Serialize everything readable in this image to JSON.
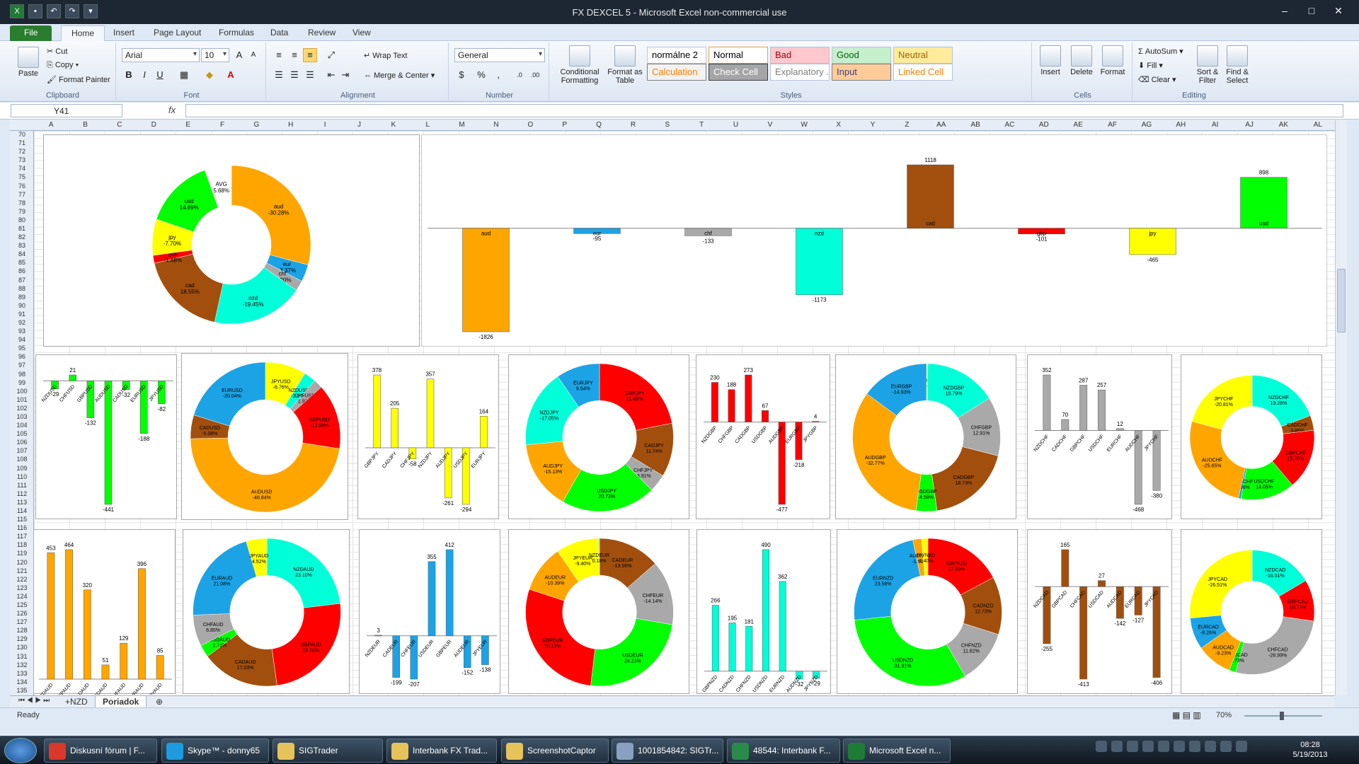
{
  "window": {
    "title": "FX DEXCEL 5  -  Microsoft Excel non-commercial use"
  },
  "tabs": [
    "File",
    "Home",
    "Insert",
    "Page Layout",
    "Formulas",
    "Data",
    "Review",
    "View"
  ],
  "ribbon": {
    "clipboard": {
      "paste": "Paste",
      "cut": "Cut",
      "copy": "Copy",
      "format_painter": "Format Painter",
      "label": "Clipboard"
    },
    "font": {
      "name": "Arial",
      "size": "10",
      "label": "Font"
    },
    "alignment": {
      "wrap": "Wrap Text",
      "merge": "Merge & Center",
      "label": "Alignment"
    },
    "number": {
      "format": "General",
      "label": "Number"
    },
    "styles": {
      "conditional": "Conditional Formatting",
      "format_table": "Format as Table",
      "cells": [
        {
          "label": "normálne 2",
          "bg": "#ffffff",
          "color": "#000000",
          "border": "#b6c4d6"
        },
        {
          "label": "Normal",
          "bg": "#ffffff",
          "color": "#000000",
          "border": "#e8a33a"
        },
        {
          "label": "Bad",
          "bg": "#ffc7ce",
          "color": "#9c0006",
          "border": "#b6c4d6"
        },
        {
          "label": "Good",
          "bg": "#c6efce",
          "color": "#006100",
          "border": "#b6c4d6"
        },
        {
          "label": "Neutral",
          "bg": "#ffeb9c",
          "color": "#9c6500",
          "border": "#b6c4d6"
        },
        {
          "label": "Calculation",
          "bg": "#f2f2f2",
          "color": "#fa7d00",
          "border": "#7f7f7f"
        },
        {
          "label": "Check Cell",
          "bg": "#a5a5a5",
          "color": "#ffffff",
          "border": "#3f3f3f"
        },
        {
          "label": "Explanatory ...",
          "bg": "#ffffff",
          "color": "#7f7f7f",
          "border": "#b6c4d6"
        },
        {
          "label": "Input",
          "bg": "#ffcc99",
          "color": "#3f3f76",
          "border": "#7f7f7f"
        },
        {
          "label": "Linked Cell",
          "bg": "#ffffff",
          "color": "#fa7d00",
          "border": "#b6c4d6"
        }
      ],
      "label": "Styles"
    },
    "cells": {
      "insert": "Insert",
      "delete": "Delete",
      "format": "Format",
      "label": "Cells"
    },
    "editing": {
      "autosum": "AutoSum",
      "fill": "Fill",
      "clear": "Clear",
      "sort": "Sort & Filter",
      "find": "Find & Select",
      "label": "Editing"
    }
  },
  "formula_bar": {
    "name_box": "Y41",
    "fx": "fx",
    "value": ""
  },
  "columns": [
    "A",
    "B",
    "C",
    "D",
    "E",
    "F",
    "G",
    "H",
    "I",
    "J",
    "K",
    "L",
    "M",
    "N",
    "O",
    "P",
    "Q",
    "R",
    "S",
    "T",
    "U",
    "V",
    "W",
    "X",
    "Y",
    "Z",
    "AA",
    "AB",
    "AC",
    "AD",
    "AE",
    "AF",
    "AG",
    "AH",
    "AI",
    "AJ",
    "AK",
    "AL"
  ],
  "row_start": 70,
  "row_end": 135,
  "sheet_tabs": [
    "+NZD",
    "Poriadok"
  ],
  "status": {
    "ready": "Ready",
    "zoom": "70%"
  },
  "taskbar": {
    "items": [
      {
        "label": "Diskusní fórum | F...",
        "color": "#d9382b"
      },
      {
        "label": "Skype™ - donny65",
        "color": "#1e9be0"
      },
      {
        "label": "SIGTrader",
        "color": "#e6c35a"
      },
      {
        "label": "Interbank FX Trad...",
        "color": "#e6c35a"
      },
      {
        "label": "ScreenshotCaptor",
        "color": "#e6c35a"
      },
      {
        "label": "1001854842: SIGTr...",
        "color": "#8aa0c0"
      },
      {
        "label": "48544: Interbank F...",
        "color": "#2a8a4a"
      },
      {
        "label": "Microsoft Excel n...",
        "color": "#1e7b34"
      }
    ],
    "time": "08:28",
    "date": "5/19/2013"
  },
  "colors": {
    "aud": "#ffa500",
    "eur": "#1ca3e6",
    "chf": "#a9a9a9",
    "nzd": "#00ffd8",
    "cad": "#a24f0e",
    "gbp": "#ff0000",
    "jpy": "#ffff00",
    "usd": "#00ff00",
    "avg": "#ffffff"
  },
  "chart_data": [
    {
      "type": "pie",
      "donut": true,
      "slices": [
        {
          "name": "aud",
          "value": -30.28,
          "label": "aud\n-30.28%"
        },
        {
          "name": "eur",
          "value": -3.67,
          "label": "eur\n-3.37%"
        },
        {
          "name": "chf",
          "value": -2.2,
          "label": "chf\n-2.20%"
        },
        {
          "name": "nzd",
          "value": -19.45,
          "label": "nzd\n-19.45%"
        },
        {
          "name": "cad",
          "value": 18.55,
          "label": "cad\n18.55%"
        },
        {
          "name": "gbp",
          "value": -1.68,
          "label": "gbp\n-1.68%"
        },
        {
          "name": "jpy",
          "value": -7.7,
          "label": "jpy\n-7.70%"
        },
        {
          "name": "usd",
          "value": 14.89,
          "label": "usd\n14.89%"
        },
        {
          "name": "avg",
          "value": 5.68,
          "label": "AVG\n5.68%"
        }
      ]
    },
    {
      "type": "bar",
      "categories": [
        "aud",
        "eur",
        "chf",
        "nzd",
        "cad",
        "gbp",
        "jpy",
        "usd"
      ],
      "values": [
        -1826,
        -95,
        -133,
        -1173,
        1118,
        -101,
        -465,
        898
      ]
    },
    {
      "type": "bar",
      "categories": [
        "NZDUSD",
        "CHFUSD",
        "GBPUSD",
        "AUDUSD",
        "CADUSD",
        "EURUSD",
        "JPYUSD"
      ],
      "values": [
        -29,
        21,
        -132,
        -441,
        -32,
        -188,
        -82
      ],
      "colors": [
        "usd"
      ]
    },
    {
      "type": "pie",
      "donut": true,
      "slices": [
        {
          "name": "jpy",
          "value": 8.76,
          "label": "JPYUSD\n-8.76%"
        },
        {
          "name": "nzd",
          "value": 2.57,
          "label": "NZDUSD\n-2.57%"
        },
        {
          "name": "chf",
          "value": 1.92,
          "label": "CHFUSD\n1.92%"
        },
        {
          "name": "gbp",
          "value": 13.98,
          "label": "GBPUSD\n-13.98%"
        },
        {
          "name": "aud",
          "value": 46.84,
          "label": "AUDUSD\n-46.84%"
        },
        {
          "name": "cad",
          "value": 5.08,
          "label": "CADUSD\n-5.08%"
        },
        {
          "name": "eur",
          "value": 20.04,
          "label": "EURUSD\n-20.04%"
        }
      ]
    },
    {
      "type": "bar",
      "categories": [
        "GBPJPY",
        "CADJPY",
        "CHFJPY",
        "NZDJPY",
        "AUDJPY",
        "USDJPY",
        "EURJPY"
      ],
      "values": [
        378,
        205,
        -58,
        357,
        -261,
        -294,
        164
      ],
      "colors": [
        "jpy"
      ]
    },
    {
      "type": "pie",
      "donut": true,
      "slices": [
        {
          "name": "gbp",
          "value": 21.89,
          "label": "GBPJPY\n21.89%"
        },
        {
          "name": "cad",
          "value": 11.74,
          "label": "CADJPY\n11.74%"
        },
        {
          "name": "chf",
          "value": 3.91,
          "label": "CHFJPY\n-3.91%"
        },
        {
          "name": "usd",
          "value": 20.73,
          "label": "USDJPY\n20.73%"
        },
        {
          "name": "aud",
          "value": 15.13,
          "label": "AUDJPY\n-15.13%"
        },
        {
          "name": "nzd",
          "value": 17.05,
          "label": "NZDJPY\n-17.05%"
        },
        {
          "name": "eur",
          "value": 9.54,
          "label": "EURJPY\n9.54%"
        }
      ]
    },
    {
      "type": "bar",
      "categories": [
        "NZDGBP",
        "CHFGBP",
        "CADGBP",
        "USDGBP",
        "AUDGBP",
        "EURGBP",
        "JPYGBP"
      ],
      "values": [
        230,
        188,
        273,
        67,
        -477,
        -218,
        4
      ],
      "colors": [
        "gbp"
      ]
    },
    {
      "type": "pie",
      "donut": true,
      "slices": [
        {
          "name": "jpy",
          "value": 0.3,
          "label": "JPYGBP\n0.30%"
        },
        {
          "name": "nzd",
          "value": 15.79,
          "label": "NZDGBP\n15.79%"
        },
        {
          "name": "chf",
          "value": 12.91,
          "label": "CHFGBP\n12.91%"
        },
        {
          "name": "cad",
          "value": 18.73,
          "label": "CADGBP\n18.73%"
        },
        {
          "name": "usd",
          "value": 4.58,
          "label": "USDGBP\n4.58%"
        },
        {
          "name": "aud",
          "value": 32.77,
          "label": "AUDGBP\n-32.77%"
        },
        {
          "name": "eur",
          "value": 14.93,
          "label": "EURGBP\n-14.93%"
        }
      ]
    },
    {
      "type": "bar",
      "categories": [
        "NZDCHF",
        "CADCHF",
        "GBPCHF",
        "USDCHF",
        "EURCHF",
        "AUDCHF",
        "JPYCHF"
      ],
      "values": [
        352,
        70,
        287,
        257,
        12,
        -468,
        -380
      ],
      "colors": [
        "chf"
      ]
    },
    {
      "type": "pie",
      "donut": true,
      "slices": [
        {
          "name": "nzd",
          "value": 19.26,
          "label": "NZDCHF\n19.26%"
        },
        {
          "name": "cad",
          "value": 3.86,
          "label": "CADCHF\n3.86%"
        },
        {
          "name": "gbp",
          "value": 15.7,
          "label": "GBPCHF\n15.70%"
        },
        {
          "name": "usd",
          "value": 14.06,
          "label": "USDCHF\n14.06%"
        },
        {
          "name": "eur",
          "value": 0.66,
          "label": "EURCHF\n0.66%"
        },
        {
          "name": "aud",
          "value": 25.65,
          "label": "AUDCHF\n-25.65%"
        },
        {
          "name": "jpy",
          "value": 20.81,
          "label": "JPYCHF\n-20.81%"
        }
      ]
    },
    {
      "type": "bar",
      "categories": [
        "NZDAUD",
        "GBPAUD",
        "CADAUD",
        "USDAUD",
        "CHFAUD",
        "EURAUD",
        "JPYAUD"
      ],
      "values": [
        453,
        464,
        320,
        51,
        129,
        396,
        85
      ],
      "colors": [
        "aud"
      ]
    },
    {
      "type": "pie",
      "donut": true,
      "slices": [
        {
          "name": "nzd",
          "value": 23.1,
          "label": "NZDAUD\n23.10%"
        },
        {
          "name": "gbp",
          "value": 24.7,
          "label": "GBPAUD\n24.70%"
        },
        {
          "name": "cad",
          "value": 17.03,
          "label": "CADAUD\n17.03%"
        },
        {
          "name": "usd",
          "value": 2.71,
          "label": "USDAUD\n2.71%"
        },
        {
          "name": "chf",
          "value": 6.85,
          "label": "CHFAUD\n6.85%"
        },
        {
          "name": "eur",
          "value": 21.08,
          "label": "EURAUD\n21.08%"
        },
        {
          "name": "jpy",
          "value": 4.52,
          "label": "JPYAUD\n4.52%"
        }
      ]
    },
    {
      "type": "bar",
      "categories": [
        "NZDEUR",
        "CADEUR",
        "CHFEUR",
        "USDEUR",
        "GBPEUR",
        "AUDEUR",
        "JPYEUR"
      ],
      "values": [
        3,
        -199,
        -207,
        355,
        412,
        -152,
        -138
      ],
      "colors": [
        "eur"
      ]
    },
    {
      "type": "pie",
      "donut": true,
      "slices": [
        {
          "name": "cad",
          "value": 13.56,
          "label": "CADEUR\n-13.56%"
        },
        {
          "name": "chf",
          "value": 14.14,
          "label": "CHFEUR\n-14.14%"
        },
        {
          "name": "usd",
          "value": 24.23,
          "label": "USDEUR\n24.23%"
        },
        {
          "name": "gbp",
          "value": 28.13,
          "label": "GBPEUR\n28.13%"
        },
        {
          "name": "aud",
          "value": 10.39,
          "label": "AUDEUR\n-10.39%"
        },
        {
          "name": "jpy",
          "value": 9.4,
          "label": "JPYEUR\n-9.40%"
        },
        {
          "name": "nzd",
          "value": 0.18,
          "label": "NZDEUR\n0.18%"
        }
      ]
    },
    {
      "type": "bar",
      "categories": [
        "GBPNZD",
        "CADNZD",
        "CHFNZD",
        "USDNZD",
        "EURNZD",
        "AUDNZD",
        "JPYNZD"
      ],
      "values": [
        266,
        195,
        181,
        490,
        362,
        -32,
        -29
      ],
      "colors": [
        "nzd"
      ]
    },
    {
      "type": "pie",
      "donut": true,
      "slices": [
        {
          "name": "gbp",
          "value": 17.33,
          "label": "GBPNZD\n17.33%"
        },
        {
          "name": "cad",
          "value": 12.73,
          "label": "CADNZD\n12.73%"
        },
        {
          "name": "chf",
          "value": 11.82,
          "label": "CHFNZD\n11.82%"
        },
        {
          "name": "usd",
          "value": 31.91,
          "label": "USDNZD\n31.91%"
        },
        {
          "name": "eur",
          "value": 23.58,
          "label": "EURNZD\n23.58%"
        },
        {
          "name": "aud",
          "value": 1.9,
          "label": "AUDNZD\n-1.90%"
        },
        {
          "name": "jpy",
          "value": 1.4,
          "label": "JPYNZD\n-1.40%"
        }
      ]
    },
    {
      "type": "bar",
      "categories": [
        "NZDCAD",
        "GBPCAD",
        "CHFCAD",
        "USDCAD",
        "AUDCAD",
        "EURCAD",
        "JPYCAD"
      ],
      "values": [
        -255,
        165,
        -413,
        27,
        -142,
        -127,
        -406
      ],
      "colors": [
        "cad"
      ]
    },
    {
      "type": "pie",
      "donut": true,
      "slices": [
        {
          "name": "nzd",
          "value": 16.51,
          "label": "NZDCAD\n-16.51%"
        },
        {
          "name": "gbp",
          "value": 10.77,
          "label": "GBPCAD\n10.77%"
        },
        {
          "name": "chf",
          "value": 26.99,
          "label": "CHFCAD\n-26.99%"
        },
        {
          "name": "usd",
          "value": 1.73,
          "label": "USDCAD\n1.73%"
        },
        {
          "name": "aud",
          "value": 9.23,
          "label": "AUDCAD\n-9.23%"
        },
        {
          "name": "eur",
          "value": 8.26,
          "label": "EURCAD\n-8.26%"
        },
        {
          "name": "jpy",
          "value": 26.51,
          "label": "JPYCAD\n-26.51%"
        }
      ]
    }
  ]
}
